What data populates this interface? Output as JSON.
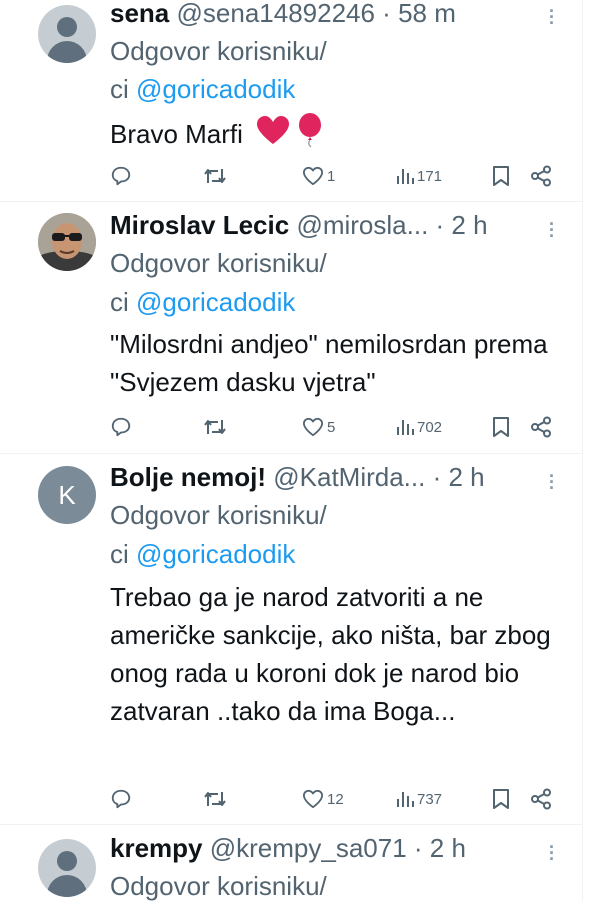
{
  "tweets": [
    {
      "name": "sena",
      "handle": "@sena14892246",
      "dot": " · ",
      "time": "58 m",
      "reply_prefix": "Odgovor korisniku/",
      "reply_prefix2": "ci ",
      "mention": "@goricadodik",
      "text": "Bravo Marfi",
      "emoji": "heart-and-balloon",
      "likes": "1",
      "views": "171",
      "avatar": "default"
    },
    {
      "name": "Miroslav Lecic",
      "handle": "@mirosla...",
      "dot": " · ",
      "time": "2 h",
      "reply_prefix": "Odgovor korisniku/",
      "reply_prefix2": "ci ",
      "mention": "@goricadodik",
      "text": "\"Milosrdni andjeo\" nemilosrdan prema \"Svjezem dasku vjetra\"",
      "likes": "5",
      "views": "702",
      "avatar": "photo"
    },
    {
      "name": "Bolje nemoj!",
      "handle": "@KatMirda...",
      "dot": " · ",
      "time": "2 h",
      "reply_prefix": "Odgovor korisniku/",
      "reply_prefix2": "ci ",
      "mention": "@goricadodik",
      "text": "Trebao ga je narod zatvoriti a ne američke sankcije, ako ništa, bar zbog onog rada u koroni dok je narod bio zatvaran ..tako da ima Boga...",
      "likes": "12",
      "views": "737",
      "avatar": "letter",
      "avatar_letter": "K"
    },
    {
      "name": "krempy",
      "handle": "@krempy_sa071",
      "dot": " · ",
      "time": "2 h",
      "reply_prefix": "Odgovor korisniku/",
      "avatar": "default"
    }
  ],
  "icons": {
    "reply": "reply-icon",
    "retweet": "retweet-icon",
    "like": "heart-icon",
    "views": "views-icon",
    "bookmark": "bookmark-icon",
    "share": "share-icon",
    "more": "more-icon"
  },
  "colors": {
    "link": "#1d9bf0",
    "secondary": "#536471",
    "heart_emoji": "#e0245e"
  }
}
